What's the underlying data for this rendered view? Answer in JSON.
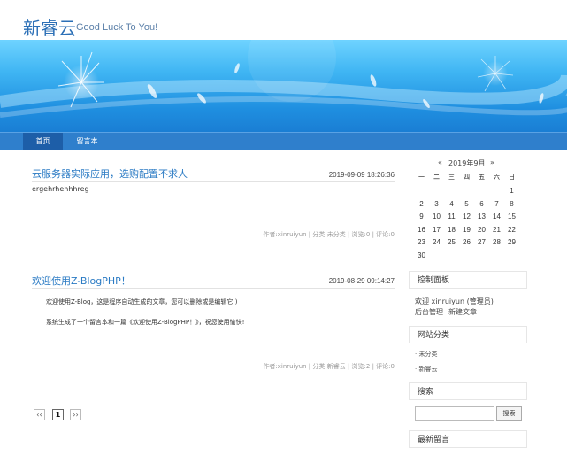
{
  "site": {
    "title": "新睿云",
    "subtitle": "Good Luck To You!"
  },
  "nav": {
    "items": [
      {
        "label": "首页"
      },
      {
        "label": "留言本"
      }
    ]
  },
  "posts": [
    {
      "title": "云服务器实际应用，选购配置不求人",
      "date": "2019-09-09 18:26:36",
      "body": [
        "ergehrhehhhreg"
      ],
      "meta": "作者:xinruiyun | 分类:未分类 | 浏览:0 | 评论:0"
    },
    {
      "title": "欢迎使用Z-BlogPHP！",
      "date": "2019-08-29 09:14:27",
      "body": [
        "欢迎使用Z-Blog，这是程序自动生成的文章，您可以删除或是编辑它:)",
        "系统生成了一个留言本和一篇《欢迎使用Z-BlogPHP！》，祝您使用愉快!"
      ],
      "meta": "作者:xinruiyun | 分类:新睿云 | 浏览:2 | 评论:0"
    }
  ],
  "pager": {
    "prev": "‹‹",
    "current": "1",
    "next": "››"
  },
  "calendar": {
    "prev": "«",
    "month": "2019年9月",
    "next": "»",
    "weekdays": [
      "一",
      "二",
      "三",
      "四",
      "五",
      "六",
      "日"
    ],
    "weeks": [
      [
        "",
        "",
        "",
        "",
        "",
        "",
        "1"
      ],
      [
        "2",
        "3",
        "4",
        "5",
        "6",
        "7",
        "8"
      ],
      [
        "9",
        "10",
        "11",
        "12",
        "13",
        "14",
        "15"
      ],
      [
        "16",
        "17",
        "18",
        "19",
        "20",
        "21",
        "22"
      ],
      [
        "23",
        "24",
        "25",
        "26",
        "27",
        "28",
        "29"
      ],
      [
        "30",
        "",
        "",
        "",
        "",
        "",
        ""
      ]
    ]
  },
  "control_panel": {
    "title": "控制面板",
    "welcome": "欢迎 xinruiyun (管理员)",
    "admin_link": "后台管理",
    "new_post_link": "新建文章"
  },
  "categories": {
    "title": "网站分类",
    "items": [
      "· 未分类",
      "· 新睿云"
    ]
  },
  "search": {
    "title": "搜索",
    "button": "搜索",
    "placeholder": ""
  },
  "recent_comments": {
    "title": "最新留言"
  }
}
